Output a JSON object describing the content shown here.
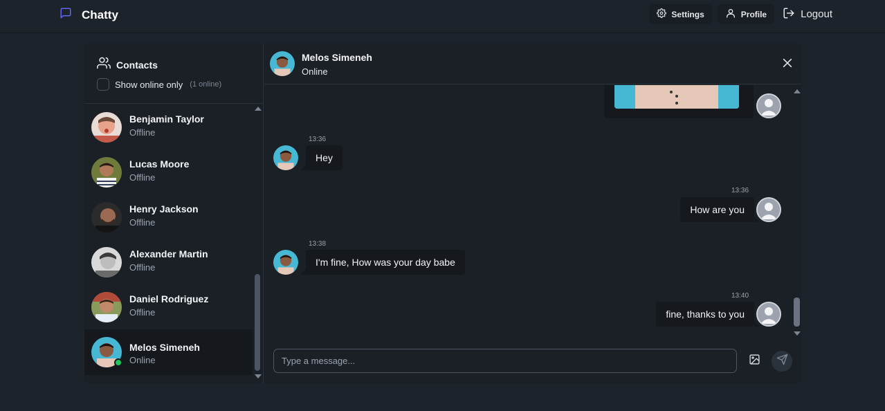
{
  "nav": {
    "brand": "Chatty",
    "settings_label": "Settings",
    "profile_label": "Profile",
    "logout_label": "Logout",
    "accent": "#6366f1"
  },
  "sidebar": {
    "title": "Contacts",
    "filter_label": "Show online only",
    "online_count": "(1 online)",
    "contacts": [
      {
        "name": "Benjamin Taylor",
        "status": "Offline"
      },
      {
        "name": "Lucas Moore",
        "status": "Offline"
      },
      {
        "name": "Henry Jackson",
        "status": "Offline"
      },
      {
        "name": "Alexander Martin",
        "status": "Offline"
      },
      {
        "name": "Daniel Rodriguez",
        "status": "Offline"
      },
      {
        "name": "Melos Simeneh",
        "status": "Online"
      }
    ]
  },
  "chat": {
    "name": "Melos Simeneh",
    "status": "Online",
    "messages": [
      {
        "time": "13:36",
        "text": "Hey"
      },
      {
        "time": "13:36",
        "text": "How are you"
      },
      {
        "time": "13:38",
        "text": "I'm fine, How was your day babe"
      },
      {
        "time": "13:40",
        "text": "fine, thanks to you"
      }
    ],
    "input_placeholder": "Type a message..."
  }
}
